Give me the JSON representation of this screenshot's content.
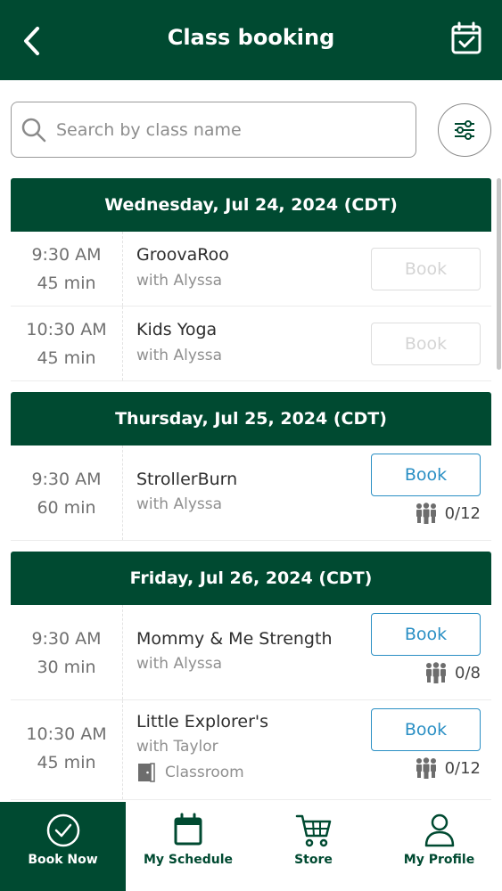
{
  "header": {
    "title": "Class booking",
    "back_icon": "chevron-left-icon",
    "calendar_icon": "calendar-check-icon"
  },
  "search": {
    "placeholder": "Search by class name",
    "value": "",
    "icon": "search-icon",
    "filter_icon": "sliders-icon"
  },
  "colors": {
    "primary": "#004a31",
    "book_active": "#2a8fc4",
    "book_disabled": "#d4d4d4"
  },
  "days": [
    {
      "label": "Wednesday, Jul 24, 2024 (CDT)",
      "classes": [
        {
          "time": "9:30  AM",
          "duration": "45 min",
          "name": "GroovaRoo",
          "instructor": "with Alyssa",
          "book_label": "Book",
          "bookable": false
        },
        {
          "time": "10:30  AM",
          "duration": "45 min",
          "name": "Kids Yoga",
          "instructor": "with Alyssa",
          "book_label": "Book",
          "bookable": false
        }
      ]
    },
    {
      "label": "Thursday, Jul 25, 2024 (CDT)",
      "classes": [
        {
          "time": "9:30  AM",
          "duration": "60 min",
          "name": "StrollerBurn",
          "instructor": "with Alyssa",
          "book_label": "Book",
          "bookable": true,
          "capacity": "0/12"
        }
      ]
    },
    {
      "label": "Friday, Jul 26, 2024 (CDT)",
      "classes": [
        {
          "time": "9:30  AM",
          "duration": "30 min",
          "name": "Mommy & Me Strength",
          "instructor": "with Alyssa",
          "book_label": "Book",
          "bookable": true,
          "capacity": "0/8"
        },
        {
          "time": "10:30  AM",
          "duration": "45 min",
          "name": "Little Explorer's",
          "instructor": "with Taylor",
          "location": "Classroom",
          "book_label": "Book",
          "bookable": true,
          "capacity": "0/12"
        }
      ]
    }
  ],
  "tabs": [
    {
      "label": "Book Now",
      "icon": "check-circle-icon",
      "active": true
    },
    {
      "label": "My Schedule",
      "icon": "calendar-icon",
      "active": false
    },
    {
      "label": "Store",
      "icon": "cart-icon",
      "active": false
    },
    {
      "label": "My Profile",
      "icon": "user-icon",
      "active": false
    }
  ]
}
